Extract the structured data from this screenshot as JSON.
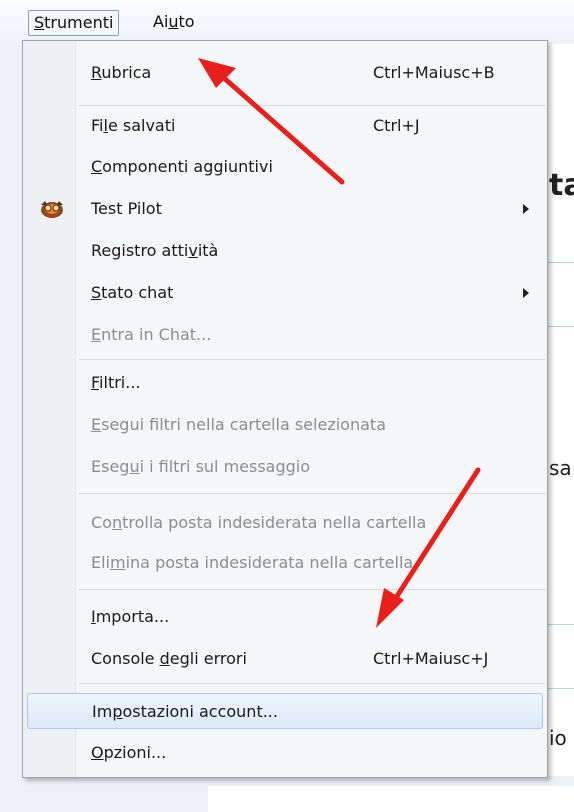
{
  "menubar": {
    "items": [
      {
        "label_underlined": "S",
        "label_rest": "trumenti"
      },
      {
        "label_pre": "Ai",
        "label_underlined": "u",
        "label_rest": "to"
      }
    ]
  },
  "background": {
    "texts": [
      "ta",
      "sa",
      "io"
    ]
  },
  "menu": {
    "items": [
      {
        "u": "R",
        "rest": "ubrica",
        "shortcut": "Ctrl+Maiusc+B"
      },
      {
        "pre": "Fi",
        "u": "l",
        "rest": "e salvati",
        "shortcut": "Ctrl+J"
      },
      {
        "u": "C",
        "rest": "omponenti aggiuntivi"
      },
      {
        "label": "Test Pilot",
        "icon": "test-pilot-icon",
        "submenu": true
      },
      {
        "pre": "Registro atti",
        "u": "v",
        "rest": "ità"
      },
      {
        "u": "S",
        "rest": "tato chat",
        "submenu": true
      },
      {
        "u": "E",
        "rest": "ntra in Chat...",
        "disabled": true
      },
      {
        "u": "F",
        "rest": "iltri..."
      },
      {
        "u": "E",
        "rest": "segui filtri nella cartella selezionata",
        "disabled": true
      },
      {
        "pre": "Eseg",
        "u": "u",
        "rest": "i i filtri sul messaggio",
        "disabled": true
      },
      {
        "pre": "Co",
        "u": "n",
        "rest": "trolla posta indesiderata nella cartella",
        "disabled": true
      },
      {
        "pre": "Eli",
        "u": "m",
        "rest": "ina posta indesiderata nella cartella",
        "disabled": true
      },
      {
        "u": "I",
        "rest": "mporta..."
      },
      {
        "pre": "Console ",
        "u": "d",
        "rest": "egli errori",
        "shortcut": "Ctrl+Maiusc+J"
      },
      {
        "pre": "Im",
        "u": "p",
        "rest": "ostazioni account...",
        "highlighted": true
      },
      {
        "u": "O",
        "rest": "pzioni..."
      }
    ]
  },
  "annotations": {
    "arrow_color": "#e8201c"
  }
}
